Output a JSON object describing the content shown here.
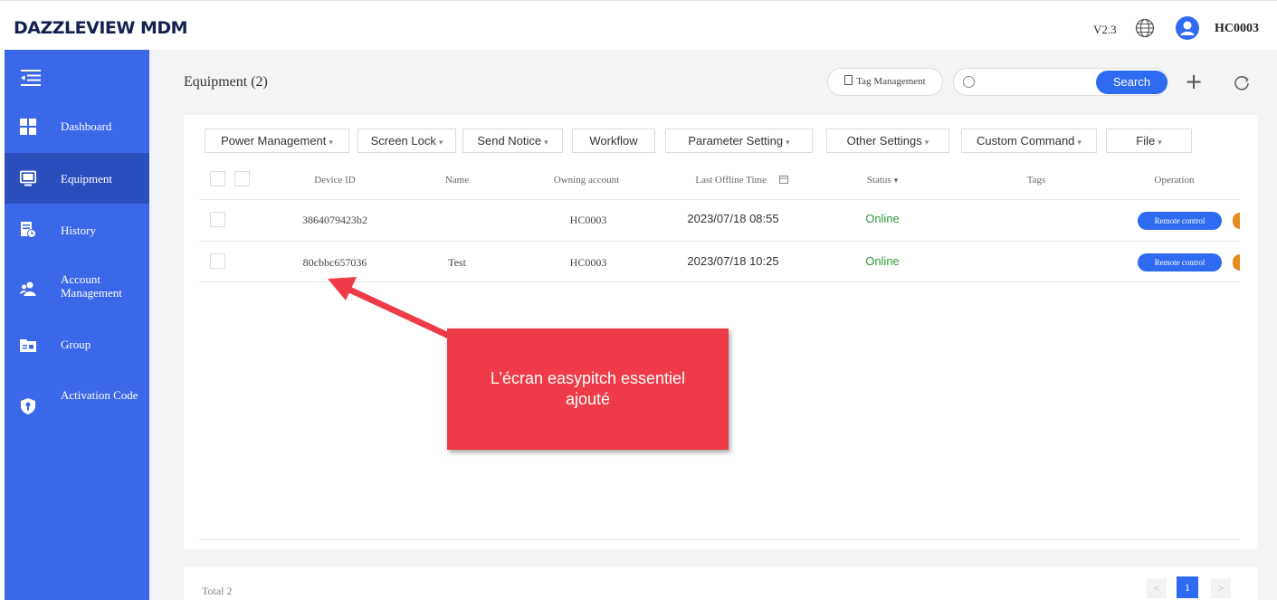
{
  "header": {
    "logo": "DAZZLEVIEW MDM",
    "version": "V2.3",
    "username": "HC0003"
  },
  "sidebar": {
    "items": [
      {
        "label": "Dashboard",
        "icon": "dashboard-icon"
      },
      {
        "label": "Equipment",
        "icon": "monitor-icon",
        "active": true
      },
      {
        "label": "History",
        "icon": "history-icon"
      },
      {
        "label": "Account Management",
        "icon": "users-icon"
      },
      {
        "label": "Group",
        "icon": "folder-icon"
      },
      {
        "label": "Activation Code",
        "icon": "key-shield-icon"
      }
    ]
  },
  "main": {
    "title": "Equipment (2)",
    "tag_management": "Tag Management",
    "search_placeholder": "",
    "search_label": "Search",
    "toolbar": [
      {
        "label": "Power Management",
        "dropdown": true
      },
      {
        "label": "Screen Lock",
        "dropdown": true
      },
      {
        "label": "Send Notice",
        "dropdown": true
      },
      {
        "label": "Workflow",
        "dropdown": false
      },
      {
        "label": "Parameter Setting",
        "dropdown": true
      },
      {
        "label": "Other Settings",
        "dropdown": true
      },
      {
        "label": "Custom Command",
        "dropdown": true
      },
      {
        "label": "File",
        "dropdown": true
      }
    ],
    "columns": {
      "device_id": "Device ID",
      "name": "Name",
      "owning_account": "Owning account",
      "last_offline": "Last Offline Time",
      "status": "Status",
      "tags": "Tags",
      "operation": "Operation"
    },
    "rows": [
      {
        "device_id": "3864079423b2",
        "name": "",
        "owning_account": "HC0003",
        "last_offline": "2023/07/18 08:55",
        "status": "Online",
        "tags": "",
        "action": "Remote control"
      },
      {
        "device_id": "80cbbc657036",
        "name": "Test",
        "owning_account": "HC0003",
        "last_offline": "2023/07/18 10:25",
        "status": "Online",
        "tags": "",
        "action": "Remote control"
      }
    ],
    "total": "Total 2",
    "pagination": {
      "prev": "<",
      "current": "1",
      "next": ">"
    }
  },
  "annotation": {
    "text_line1": "L’écran easypitch essentiel",
    "text_line2": "ajouté"
  },
  "colors": {
    "sidebar": "#3b68e8",
    "sidebar_active": "#2a4fbd",
    "primary": "#2f6bf0",
    "online": "#2e9b3a",
    "callout": "#ee3b47"
  }
}
